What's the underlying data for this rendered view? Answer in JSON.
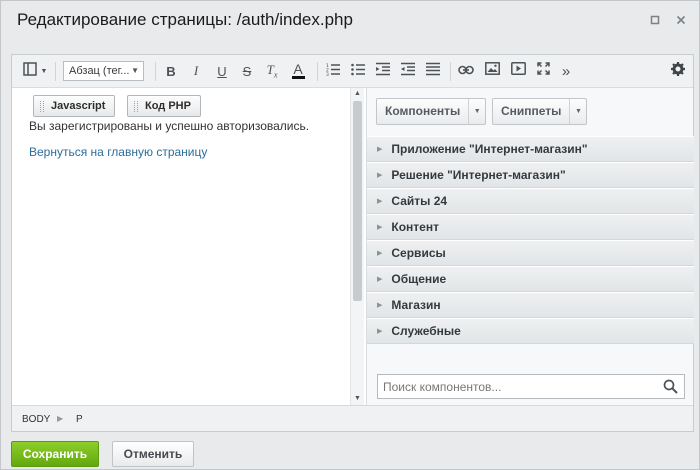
{
  "window": {
    "title": "Редактирование страницы: /auth/index.php"
  },
  "toolbar": {
    "format_select": "Абзац (тег...",
    "icons": [
      "view-mode-icon",
      "bold-icon",
      "italic-icon",
      "underline-icon",
      "strikethrough-icon",
      "remove-format-icon",
      "font-color-icon",
      "ordered-list-icon",
      "unordered-list-icon",
      "outdent-icon",
      "indent-icon",
      "align-icon",
      "link-icon",
      "image-icon",
      "video-icon",
      "fullscreen-icon",
      "more-icon",
      "settings-icon"
    ],
    "bold": "B",
    "italic": "I",
    "underline": "U",
    "strike": "S",
    "remove_format": "T",
    "remove_format_sub": "x",
    "font_color": "A",
    "more": "»"
  },
  "content": {
    "js_button": "Javascript",
    "php_button": "Код PHP",
    "paragraph": "Вы зарегистрированы и успешно авторизовались.",
    "link": "Вернуться на главную страницу"
  },
  "panel": {
    "components_tab": "Компоненты",
    "snippets_tab": "Сниппеты",
    "groups": [
      {
        "label": "Приложение \"Интернет-магазин\""
      },
      {
        "label": "Решение \"Интернет-магазин\""
      },
      {
        "label": "Сайты 24"
      },
      {
        "label": "Контент"
      },
      {
        "label": "Сервисы"
      },
      {
        "label": "Общение"
      },
      {
        "label": "Магазин"
      },
      {
        "label": "Служебные"
      }
    ],
    "search_placeholder": "Поиск компонентов..."
  },
  "statusbar": {
    "crumbs": [
      "BODY",
      "P"
    ]
  },
  "footer": {
    "save_label": "Сохранить",
    "cancel_label": "Отменить"
  },
  "colors": {
    "save_green": "#6ab517",
    "link_blue": "#2b6d9a",
    "group_bg": "#e6e8ea"
  }
}
